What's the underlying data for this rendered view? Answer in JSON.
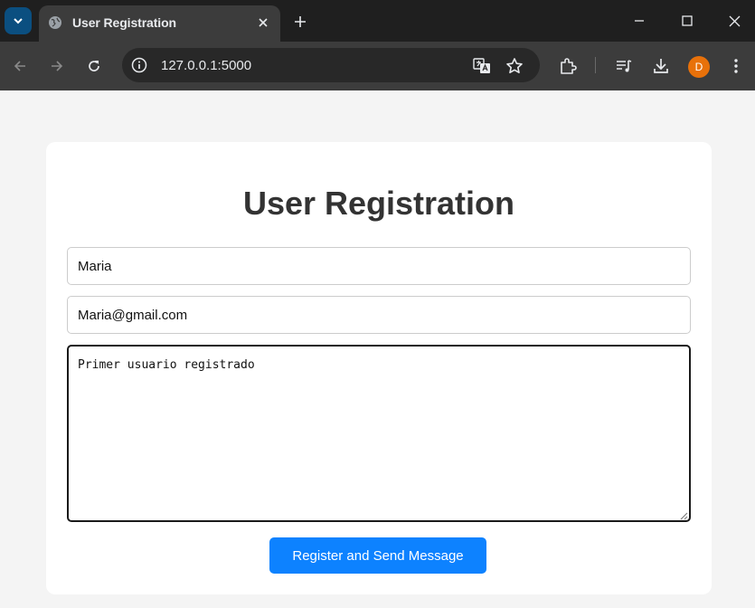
{
  "browser": {
    "tab": {
      "title": "User Registration",
      "favicon": "globe-icon"
    },
    "address_bar": {
      "url": "127.0.0.1:5000"
    },
    "profile": {
      "initial": "D",
      "color": "#e8710a"
    }
  },
  "page": {
    "title": "User Registration",
    "form": {
      "name_value": "Maria",
      "email_value": "Maria@gmail.com",
      "message_value": "Primer usuario registrado",
      "submit_label": "Register and Send Message"
    }
  },
  "colors": {
    "accent": "#0d82ff",
    "page_background": "#f4f4f4",
    "card_background": "#ffffff",
    "title_text": "#333333"
  }
}
